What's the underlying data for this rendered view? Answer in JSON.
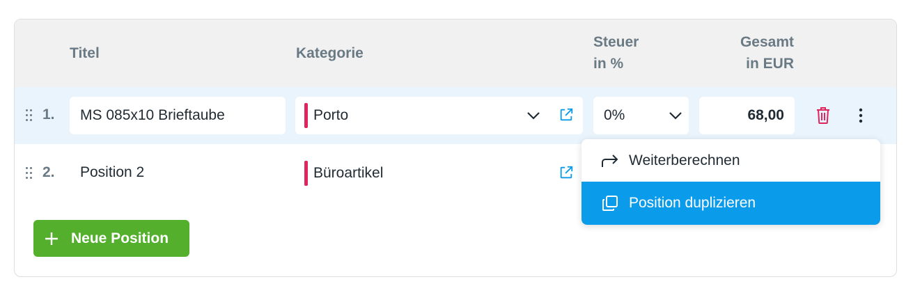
{
  "header": {
    "title_label": "Titel",
    "category_label": "Kategorie",
    "tax_label": "Steuer",
    "tax_unit": "in %",
    "total_label": "Gesamt",
    "total_unit": "in EUR"
  },
  "rows": [
    {
      "index": "1.",
      "title": "MS 085x10 Brieftaube",
      "category": "Porto",
      "tax": "0%",
      "total": "68,00"
    },
    {
      "index": "2.",
      "title": "Position 2",
      "category": "Büroartikel"
    }
  ],
  "add_button": {
    "label": "Neue Position"
  },
  "context_menu": {
    "items": [
      {
        "label": "Weiterberechnen",
        "icon": "forward-arrow-icon"
      },
      {
        "label": "Position duplizieren",
        "icon": "duplicate-icon",
        "active": true
      }
    ]
  },
  "colors": {
    "accent": "#0a9bea",
    "category_marker": "#e0245e",
    "add_button": "#54b02c",
    "delete": "#e0245e",
    "header_bg": "#f1f1f1",
    "active_row_bg": "#eaf4fc"
  }
}
